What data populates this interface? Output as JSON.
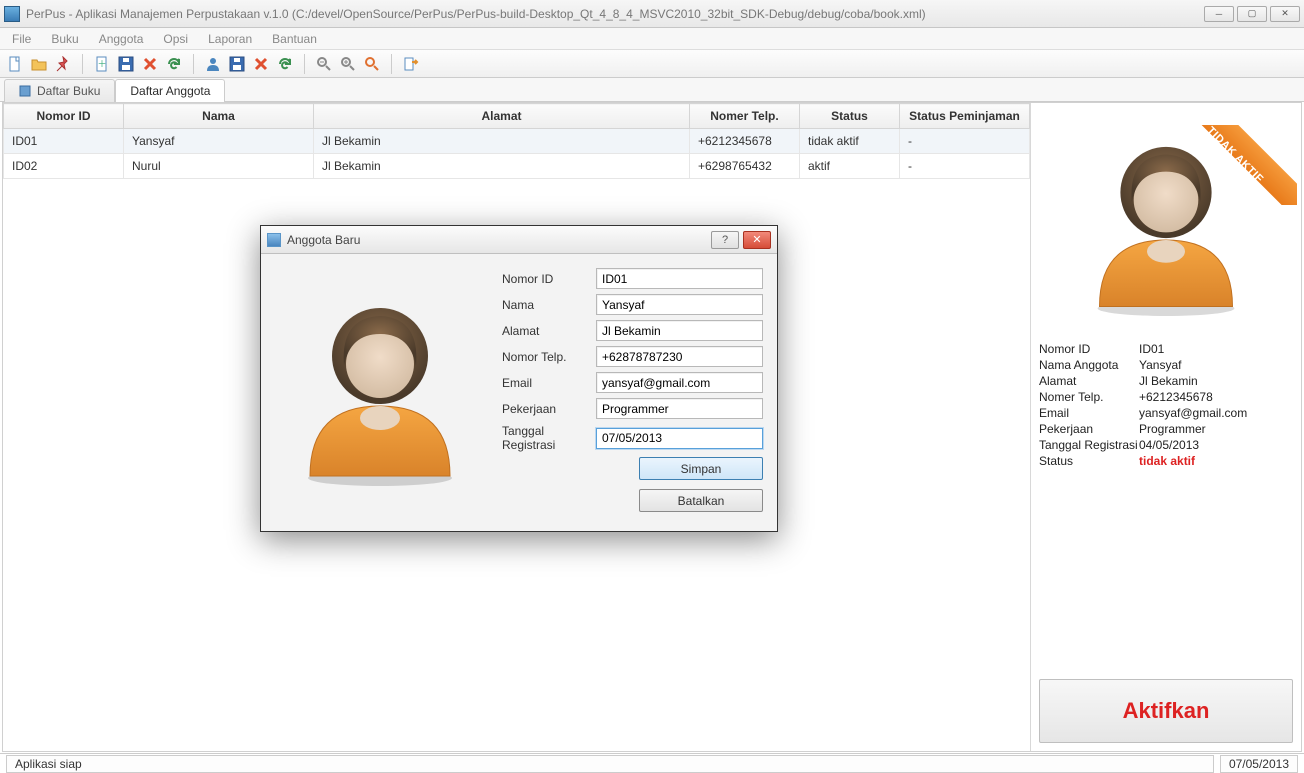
{
  "window": {
    "title": "PerPus - Aplikasi Manajemen Perpustakaan v.1.0 (C:/devel/OpenSource/PerPus/PerPus-build-Desktop_Qt_4_8_4_MSVC2010_32bit_SDK-Debug/debug/coba/book.xml)"
  },
  "menus": [
    "File",
    "Buku",
    "Anggota",
    "Opsi",
    "Laporan",
    "Bantuan"
  ],
  "tabs": {
    "book": "Daftar Buku",
    "member": "Daftar Anggota"
  },
  "table": {
    "columns": [
      "Nomor ID",
      "Nama",
      "Alamat",
      "Nomer Telp.",
      "Status",
      "Status Peminjaman"
    ],
    "rows": [
      {
        "id": "ID01",
        "name": "Yansyaf",
        "addr": "Jl Bekamin",
        "tel": "+6212345678",
        "status": "tidak aktif",
        "loan": "-"
      },
      {
        "id": "ID02",
        "name": "Nurul",
        "addr": "Jl Bekamin",
        "tel": "+6298765432",
        "status": "aktif",
        "loan": "-"
      }
    ]
  },
  "dialog": {
    "title": "Anggota Baru",
    "labels": {
      "id": "Nomor ID",
      "name": "Nama",
      "addr": "Alamat",
      "tel": "Nomor Telp.",
      "email": "Email",
      "job": "Pekerjaan",
      "reg": "Tanggal Registrasi"
    },
    "values": {
      "id": "ID01",
      "name": "Yansyaf",
      "addr": "Jl Bekamin",
      "tel": "+62878787230",
      "email": "yansyaf@gmail.com",
      "job": "Programmer",
      "reg": "07/05/2013"
    },
    "buttons": {
      "save": "Simpan",
      "cancel": "Batalkan"
    }
  },
  "side": {
    "ribbon": "TIDAK AKTIF",
    "labels": {
      "id": "Nomor ID",
      "name": "Nama Anggota",
      "addr": "Alamat",
      "tel": "Nomer Telp.",
      "email": "Email",
      "job": "Pekerjaan",
      "reg": "Tanggal Registrasi",
      "status": "Status"
    },
    "values": {
      "id": "ID01",
      "name": "Yansyaf",
      "addr": "Jl Bekamin",
      "tel": "+6212345678",
      "email": "yansyaf@gmail.com",
      "job": "Programmer",
      "reg": "04/05/2013",
      "status": "tidak aktif"
    },
    "activate": "Aktifkan"
  },
  "statusbar": {
    "left": "Aplikasi siap",
    "right": "07/05/2013"
  }
}
